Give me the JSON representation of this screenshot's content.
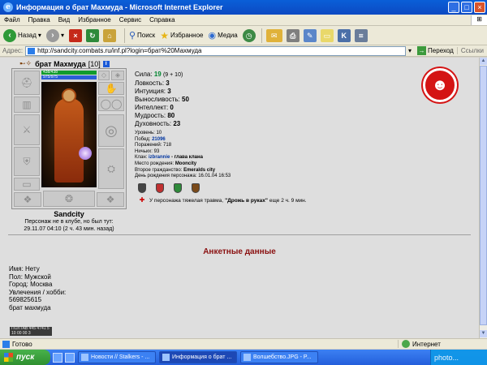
{
  "window": {
    "title": "Информация о брат Махмуда - Microsoft Internet Explorer",
    "controls": [
      "_",
      "□",
      "×"
    ]
  },
  "menu": [
    "Файл",
    "Правка",
    "Вид",
    "Избранное",
    "Сервис",
    "Справка"
  ],
  "toolbar": {
    "back_label": "Назад",
    "search_label": "Поиск",
    "favorites_label": "Избранное",
    "media_label": "Медиа"
  },
  "address": {
    "label": "Адрес:",
    "url": "http://sandcity.combats.ru/inf.pl?login=брат%20Махмуда",
    "go_label": "Переход",
    "links_label": "Ссылки"
  },
  "character": {
    "name": "брат Махмуда",
    "level": "[10]",
    "hp": "438/438",
    "mana": "975/975",
    "city": "Sandcity",
    "note_line1": "Персонаж не в клубе, но был тут:",
    "note_line2": "29.11.07 04:10 (2 ч. 43 мин. назад)"
  },
  "stats": [
    {
      "label": "Сила:",
      "value": "19",
      "bonus": "(9 + 10)",
      "green": true
    },
    {
      "label": "Ловкость:",
      "value": "3",
      "bonus": "",
      "green": false
    },
    {
      "label": "Интуиция:",
      "value": "3",
      "bonus": "",
      "green": false
    },
    {
      "label": "Выносливость:",
      "value": "50",
      "bonus": "",
      "green": false
    },
    {
      "label": "Интеллект:",
      "value": "0",
      "bonus": "",
      "green": false
    },
    {
      "label": "Мудрость:",
      "value": "80",
      "bonus": "",
      "green": false
    },
    {
      "label": "Духовность:",
      "value": "23",
      "bonus": "",
      "green": false
    }
  ],
  "info": {
    "level": "Уровень: 10",
    "wins_label": "Побед:",
    "wins": "21096",
    "losses": "Поражений: 718",
    "draws": "Ничьих: 93",
    "clan_label": "Клан:",
    "clan": "izbrannie",
    "clan_role": "- глава клана",
    "birthplace_label": "Место рождения:",
    "birthplace": "Mooncity",
    "second_label": "Второе гражданство:",
    "second": "Emeralds city",
    "birthday": "День рождения персонажа: 16.01.04 16:53"
  },
  "clan_icon_colors": [
    "#444444",
    "#c03030",
    "#2e8a3a",
    "#7a4a1a"
  ],
  "trauma": {
    "text_before": "У персонажа тяжелая травма,",
    "name": "\"Дрожь в руках\"",
    "text_after": "еще 2 ч. 9 мин."
  },
  "anketa": {
    "title": "Анкетные данные",
    "lines": [
      "Имя: Нету",
      "Пол: Мужской",
      "Город: Москва",
      "Увлечения / хобби:",
      "569825615",
      "брат махмуда"
    ],
    "counter_line1": "ПОЛТАВ 445 4741 5",
    "counter_line2": "10 00 00 3"
  },
  "status": {
    "done": "Готово",
    "zone": "Интернет"
  },
  "taskbar": {
    "start": "пуск",
    "tasks": [
      "Новости // Stalkers - ...",
      "Информация о брат ...",
      "Волшебство.JPG - P..."
    ],
    "tray": "photo..."
  },
  "colors": {
    "title_bar": "#0c49c2",
    "clan_emblem": "#d41414",
    "anketa_title": "#8a1010",
    "stat_green": "#00862f"
  }
}
